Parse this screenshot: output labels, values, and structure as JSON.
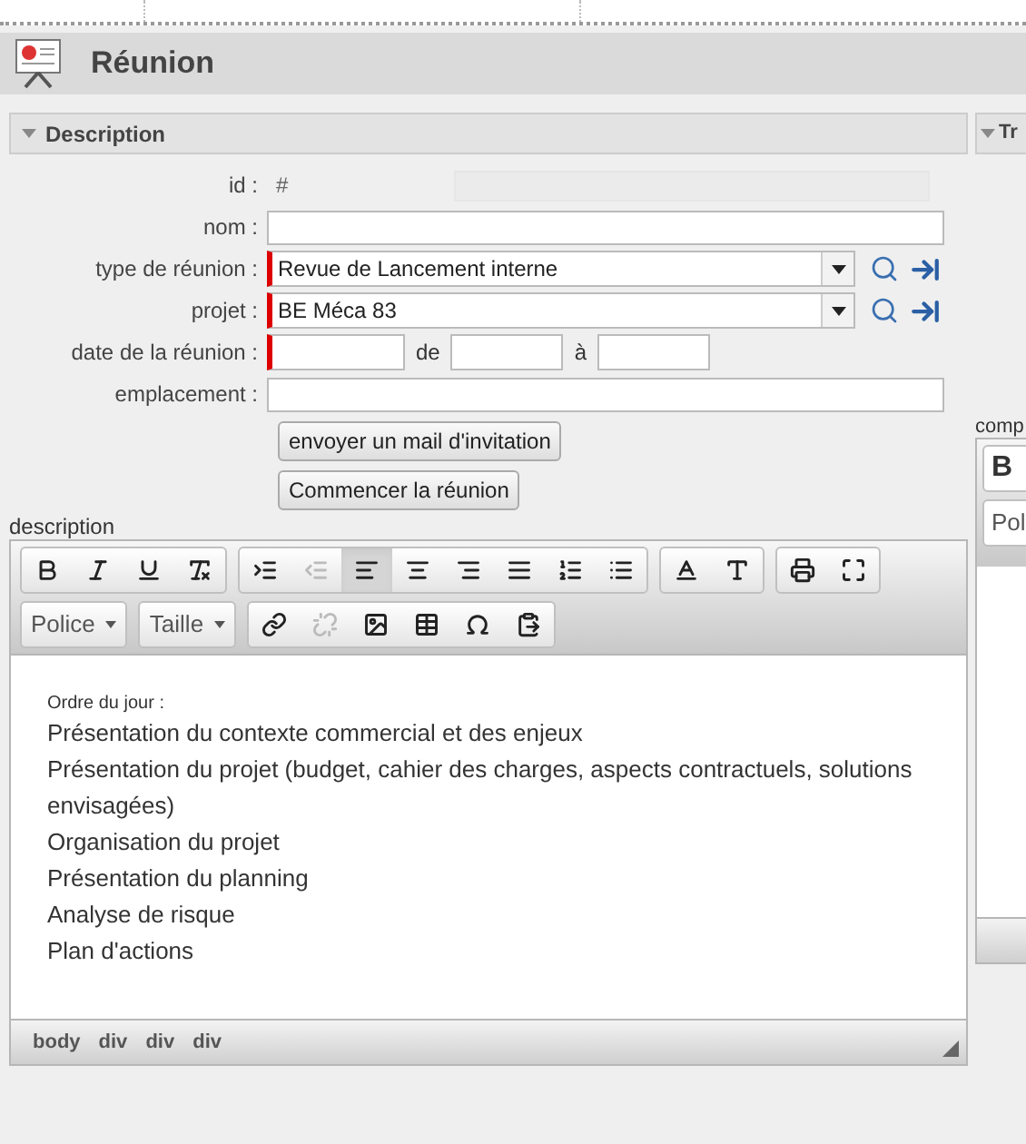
{
  "header": {
    "title": "Réunion"
  },
  "panel": {
    "title": "Description",
    "expanded": true
  },
  "side_panel": {
    "title": "Tr",
    "field_label": "comp",
    "button": "B",
    "dropdown": "Pol"
  },
  "form": [
    {
      "kind": "static",
      "label": "id :",
      "value": "#"
    },
    {
      "kind": "text",
      "label": "nom :",
      "required": false
    },
    {
      "kind": "select",
      "label": "type de réunion :",
      "value": "Revue de Lancement interne",
      "required": true
    },
    {
      "kind": "select",
      "label": "projet :",
      "value": "BE Méca 83",
      "required": true
    },
    {
      "kind": "date",
      "label": "date de la réunion :",
      "required": true,
      "from_label": "de",
      "to_label": "à"
    },
    {
      "kind": "text",
      "label": "emplacement :",
      "required": false
    }
  ],
  "actions": [
    "envoyer un mail d'invitation",
    "Commencer la réunion"
  ],
  "editor": {
    "label": "description",
    "toolbar_rows": [
      [
        [
          {
            "kind": "bold",
            "selected": false,
            "disabled": false
          },
          {
            "kind": "italic",
            "selected": false,
            "disabled": false
          },
          {
            "kind": "underline",
            "selected": false,
            "disabled": false
          },
          {
            "kind": "clear",
            "selected": false,
            "disabled": false
          }
        ],
        [
          {
            "kind": "indent",
            "selected": false,
            "disabled": false
          },
          {
            "kind": "outdent",
            "selected": false,
            "disabled": true
          },
          {
            "kind": "align-left",
            "selected": true,
            "disabled": false
          },
          {
            "kind": "align-center",
            "selected": false,
            "disabled": false
          },
          {
            "kind": "align-right",
            "selected": false,
            "disabled": false
          },
          {
            "kind": "justify",
            "selected": false,
            "disabled": false
          },
          {
            "kind": "numbered-list",
            "selected": false,
            "disabled": false
          },
          {
            "kind": "bullet-list",
            "selected": false,
            "disabled": false
          }
        ],
        [
          {
            "kind": "text-color",
            "selected": false,
            "disabled": false
          },
          {
            "kind": "bg-color",
            "selected": false,
            "disabled": false
          }
        ],
        [
          {
            "kind": "print",
            "selected": false,
            "disabled": false
          },
          {
            "kind": "maximize",
            "selected": false,
            "disabled": false
          }
        ]
      ],
      [
        [
          {
            "kind": "dropdown",
            "label": "Police"
          }
        ],
        [
          {
            "kind": "dropdown",
            "label": "Taille"
          }
        ],
        [
          {
            "kind": "link",
            "selected": false,
            "disabled": false
          },
          {
            "kind": "unlink",
            "selected": false,
            "disabled": true
          },
          {
            "kind": "image",
            "selected": false,
            "disabled": false
          },
          {
            "kind": "table",
            "selected": false,
            "disabled": false
          },
          {
            "kind": "special-char",
            "selected": false,
            "disabled": false
          },
          {
            "kind": "paste-word",
            "selected": false,
            "disabled": false
          }
        ]
      ]
    ],
    "heading": "Ordre du jour :",
    "lines": [
      "Présentation du contexte commercial et des enjeux",
      "Présentation du projet (budget, cahier des charges, aspects contractuels, solutions envisagées)",
      "Organisation du projet",
      "Présentation du planning",
      "Analyse de risque",
      "Plan d'actions"
    ],
    "path": [
      "body",
      "div",
      "div",
      "div"
    ]
  }
}
